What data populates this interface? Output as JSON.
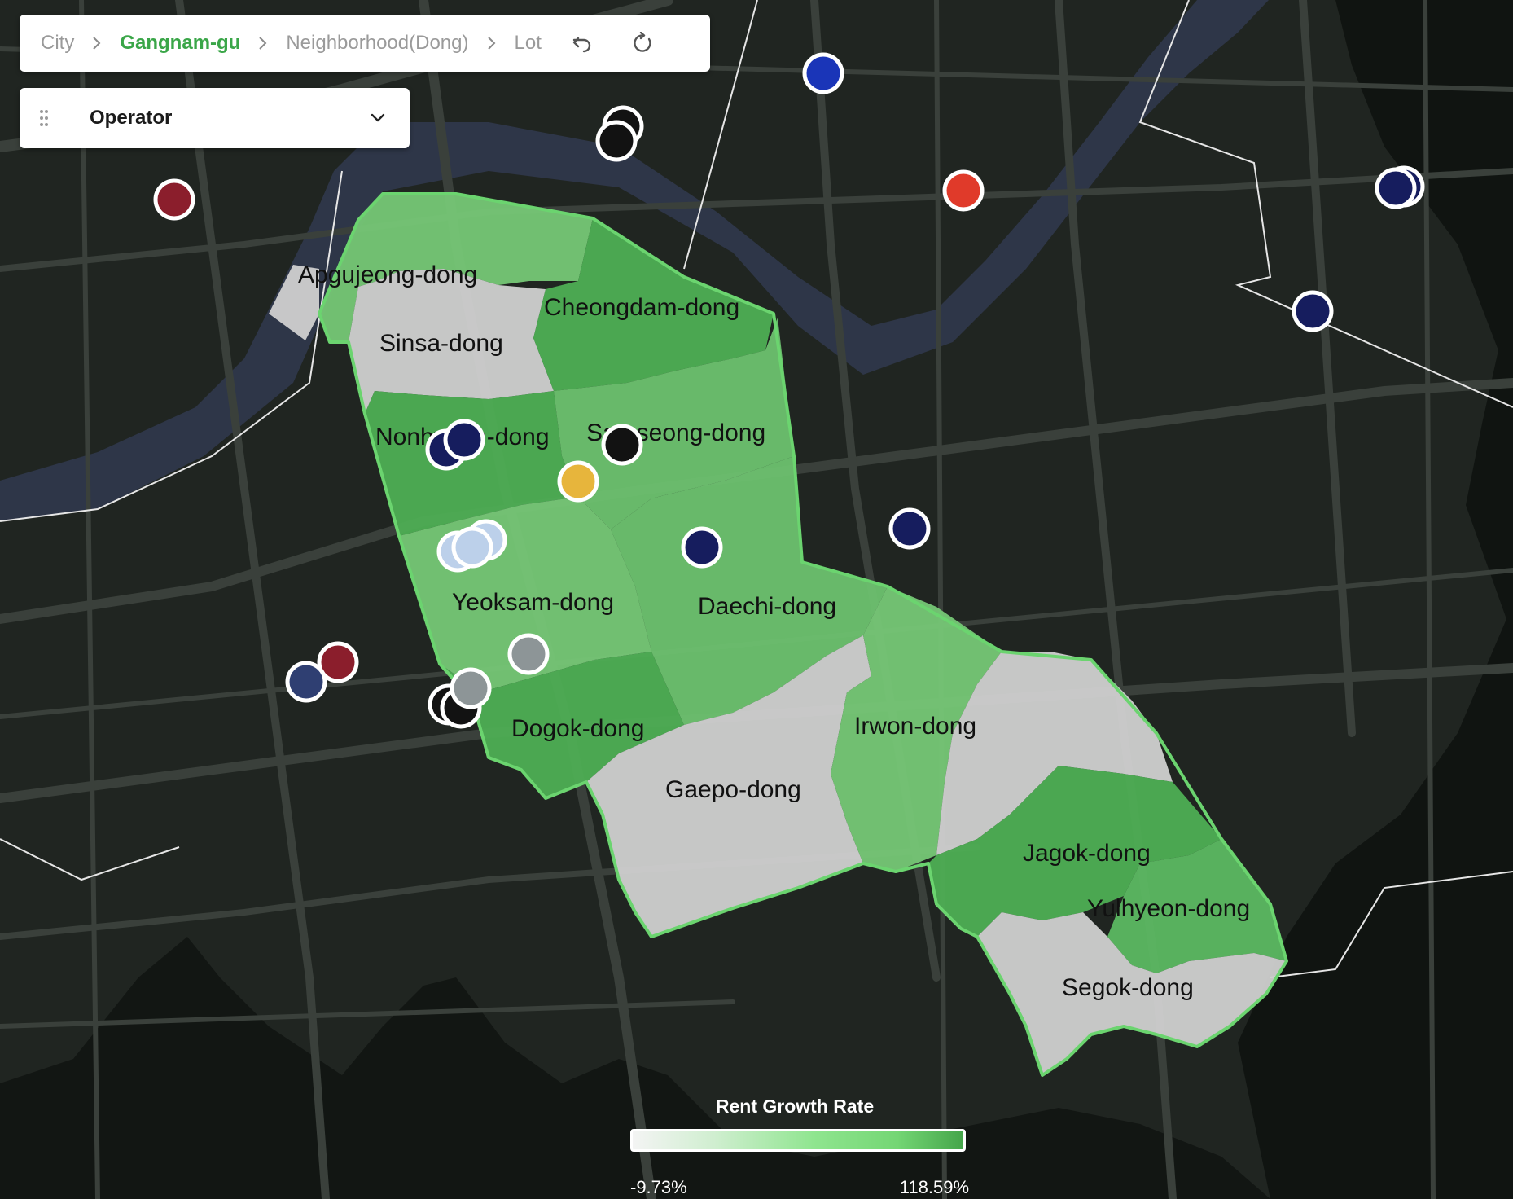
{
  "breadcrumb": {
    "items": [
      {
        "label": "City",
        "active": false
      },
      {
        "label": "Gangnam-gu",
        "active": true
      },
      {
        "label": "Neighborhood(Dong)",
        "active": false
      },
      {
        "label": "Lot",
        "active": false
      }
    ],
    "undo_icon": "undo-icon",
    "reset_icon": "reset-icon"
  },
  "operator_dropdown": {
    "label": "Operator",
    "grip_icon": "drag-handle-icon",
    "chevron_icon": "chevron-down-icon"
  },
  "map": {
    "district": "Gangnam-gu",
    "neighborhoods": [
      {
        "name": "Apgujeong-dong",
        "fill": "#76c776"
      },
      {
        "name": "Sinsa-dong",
        "fill": "#d0d0d0"
      },
      {
        "name": "Cheongdam-dong",
        "fill": "#4eae54"
      },
      {
        "name": "Nonhyeon-dong",
        "fill": "#4eae54"
      },
      {
        "name": "Samseong-dong",
        "fill": "#6dc16f"
      },
      {
        "name": "Yeoksam-dong",
        "fill": "#76c776"
      },
      {
        "name": "Daechi-dong",
        "fill": "#6dc16f"
      },
      {
        "name": "Dogok-dong",
        "fill": "#4eae54"
      },
      {
        "name": "Gaepo-dong",
        "fill": "#d0d0d0"
      },
      {
        "name": "Irwon-dong",
        "fill": "#76c776"
      },
      {
        "name": "Jagok-dong",
        "fill": "#4eae54"
      },
      {
        "name": "Yulhyeon-dong",
        "fill": "#5cb862"
      },
      {
        "name": "Segok-dong",
        "fill": "#d0d0d0"
      }
    ],
    "marker_colors": {
      "dark_red": "#8b1e2c",
      "red": "#e03a2a",
      "blue": "#1a35b8",
      "navy": "#161d5e",
      "black": "#121212",
      "yellow": "#e7b53c",
      "gray": "#8d9597",
      "light_blue": "#bcd0ea",
      "slate": "#2f3f72"
    }
  },
  "legend": {
    "title": "Rent Growth Rate",
    "min_label": "-9.73%",
    "max_label": "118.59%",
    "color_min": "#f4f4f4",
    "color_max": "#45a54a"
  }
}
